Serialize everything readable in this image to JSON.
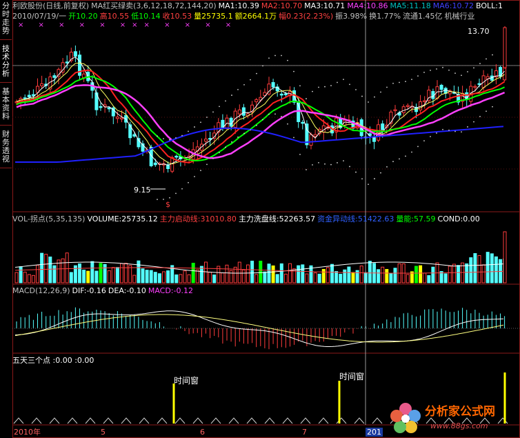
{
  "sidebar": {
    "tabs": [
      "分时走势",
      "技术分析",
      "基本资料",
      "财务透视"
    ]
  },
  "header": {
    "line1": [
      {
        "text": "利欧股份(日线,前复权)",
        "color": "#c0c0c0"
      },
      {
        "text": "MA红买绿卖(3,6,12,18,72,144,20)",
        "color": "#c0c0c0"
      },
      {
        "text": "MA1:10.39",
        "color": "#ffffff"
      },
      {
        "text": "MA2:10.70",
        "color": "#ff4040"
      },
      {
        "text": "MA3:10.71",
        "color": "#ffffff"
      },
      {
        "text": "MA4:10.86",
        "color": "#ff40ff"
      },
      {
        "text": "MA5:11.18",
        "color": "#00c0c0"
      },
      {
        "text": "MA6:10.72",
        "color": "#4040ff"
      },
      {
        "text": "BOLL:1",
        "color": "#ffffff"
      }
    ],
    "line2": [
      {
        "text": "2010/07/19/一",
        "color": "#c0c0c0"
      },
      {
        "text": "开10.20",
        "color": "#00ff00"
      },
      {
        "text": "高10.55",
        "color": "#ff4040"
      },
      {
        "text": "低10.14",
        "color": "#00ff00"
      },
      {
        "text": "收10.53",
        "color": "#ff4040"
      },
      {
        "text": "量25735.1",
        "color": "#ffff00"
      },
      {
        "text": "额2664.1万",
        "color": "#ffff00"
      },
      {
        "text": "幅0.23(2.23%)",
        "color": "#ff4040"
      },
      {
        "text": "振3.98%",
        "color": "#c0c0c0"
      },
      {
        "text": "换1.77%",
        "color": "#c0c0c0"
      },
      {
        "text": "流通1.45亿",
        "color": "#c0c0c0"
      },
      {
        "text": "机械行业",
        "color": "#c0c0c0"
      }
    ]
  },
  "price_panel": {
    "high_label": "13.70",
    "low_label": "9.15",
    "signal_mark": "$"
  },
  "volume_panel": {
    "items": [
      {
        "text": "VOL-拐点(5,35,135)",
        "color": "#c0c0c0"
      },
      {
        "text": "VOLUME:25735.12",
        "color": "#ffffff"
      },
      {
        "text": "主力启动线:31010.80",
        "color": "#ff4040"
      },
      {
        "text": "主力洗盘线:52263.57",
        "color": "#ffffff"
      },
      {
        "text": "资金异动线:51422.63",
        "color": "#3060ff"
      },
      {
        "text": "量能:57.59",
        "color": "#00ff00"
      },
      {
        "text": "COND:0.00",
        "color": "#ffffff"
      }
    ]
  },
  "macd_panel": {
    "items": [
      {
        "text": "MACD(12,26,9)",
        "color": "#c0c0c0"
      },
      {
        "text": "DIF:-0.16",
        "color": "#ffffff"
      },
      {
        "text": "DEA:-0.10",
        "color": "#ffffff"
      },
      {
        "text": "MACD:-0.12",
        "color": "#ff40ff"
      }
    ]
  },
  "five_day_panel": {
    "title": "五天三个点",
    "values": ":0.00  :0.00",
    "marker_label": "时间窗"
  },
  "date_axis": [
    "2010年",
    "5",
    "6",
    "7",
    "201"
  ],
  "watermark": {
    "name": "分析家公式网",
    "url": "www.88gs.com"
  },
  "colors": {
    "up": "#ff3c3c",
    "down": "#54ffff",
    "frame": "#8b1a1a",
    "ma_white": "#ffffff",
    "ma_red": "#ff2020",
    "ma_yellow": "#ffff60",
    "ma_purple": "#ff40ff",
    "ma_green": "#00ff00",
    "ma_blue": "#2020ff"
  }
}
